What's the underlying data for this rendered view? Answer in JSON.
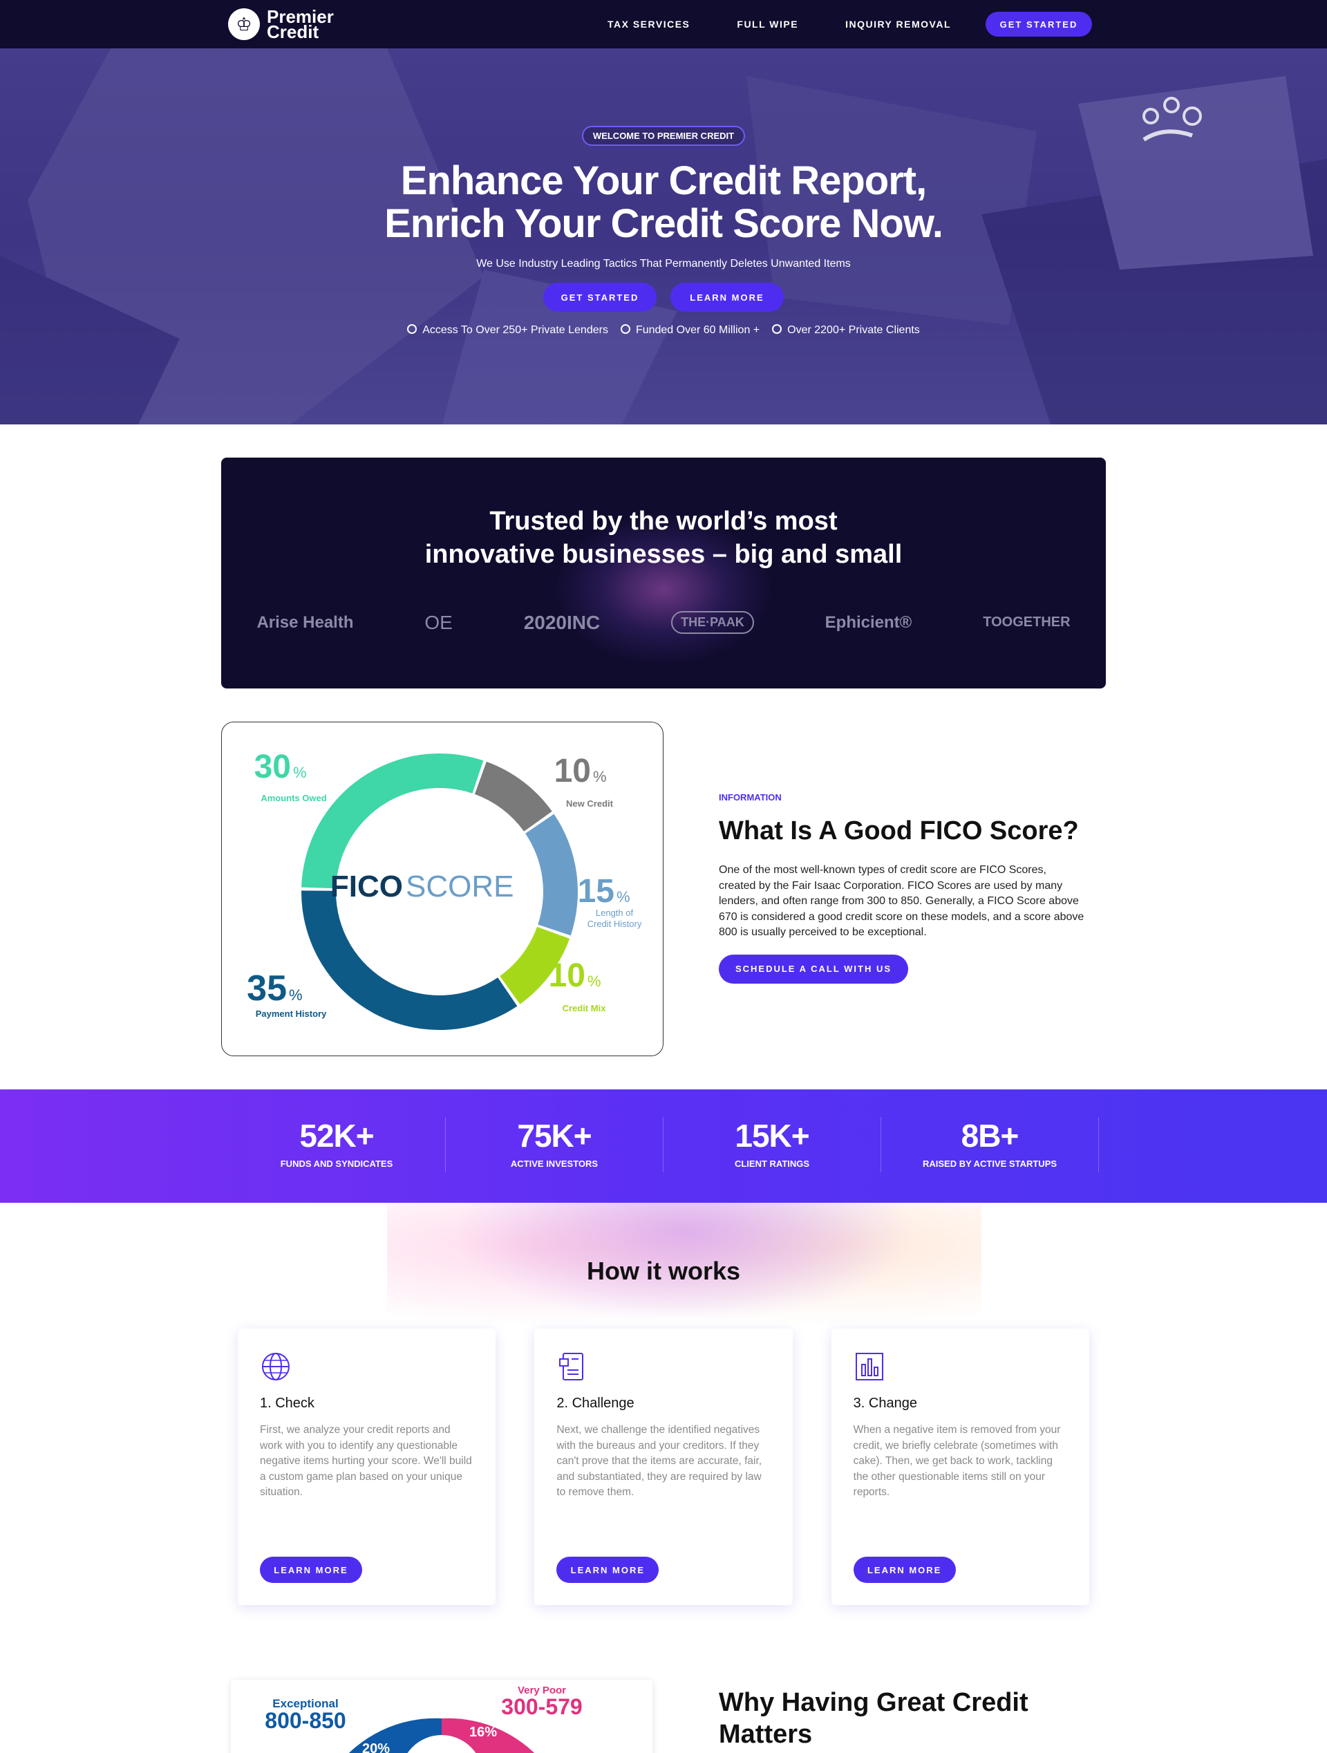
{
  "nav": {
    "logo_line1": "Premier",
    "logo_line2": "Credit",
    "links": [
      "TAX SERVICES",
      "FULL WIPE",
      "INQUIRY REMOVAL"
    ],
    "cta": "GET STARTED"
  },
  "hero": {
    "pill": "WELCOME TO PREMIER CREDIT",
    "title_line1": "Enhance Your Credit Report,",
    "title_line2": "Enrich Your Credit Score Now.",
    "subtitle": "We Use Industry Leading Tactics That Permanently Deletes Unwanted Items",
    "btn_primary": "GET STARTED",
    "btn_secondary": "LEARN MORE",
    "bullets": [
      "Access To Over 250+ Private Lenders",
      "Funded Over 60 Million +",
      "Over 2200+ Private Clients"
    ]
  },
  "trusted": {
    "title_line1": "Trusted by the world’s most",
    "title_line2": "innovative businesses – big and small",
    "brands": [
      "Arise Health",
      "OE",
      "2020INC",
      "THE·PAAK",
      "Ephicient®",
      "TOOGETHER"
    ]
  },
  "fico": {
    "center_bold": "FICO",
    "center_light": "SCORE",
    "segments": [
      {
        "pct": "30",
        "label": "Amounts Owed",
        "color": "#3fd6a8",
        "value": 30
      },
      {
        "pct": "10",
        "label": "New Credit",
        "color": "#7a7a7a",
        "value": 10
      },
      {
        "pct": "15",
        "label1": "Length of",
        "label2": "Credit History",
        "color": "#6a9ec8",
        "value": 15
      },
      {
        "pct": "10",
        "label": "Credit Mix",
        "color": "#a6d81a",
        "value": 10
      },
      {
        "pct": "35",
        "label": "Payment History",
        "color": "#0e5a86",
        "value": 35
      }
    ],
    "tag": "INFORMATION",
    "title": "What Is A Good FICO Score?",
    "body": "One of the most well-known types of credit score are FICO Scores, created by the Fair Isaac Corporation. FICO Scores are used by many lenders, and often range from 300 to 850. Generally, a FICO Score above 670 is considered a good credit score on these models, and a score above 800 is usually perceived to be exceptional.",
    "cta": "SCHEDULE A CALL WITH US"
  },
  "stats": [
    {
      "num": "52K+",
      "label": "FUNDS AND SYNDICATES"
    },
    {
      "num": "75K+",
      "label": "ACTIVE INVESTORS"
    },
    {
      "num": "15K+",
      "label": "CLIENT RATINGS"
    },
    {
      "num": "8B+",
      "label": "RAISED BY ACTIVE STARTUPS"
    }
  ],
  "how": {
    "title": "How it works",
    "cards": [
      {
        "icon": "globe-icon",
        "title": "1. Check",
        "body": "First, we analyze your credit reports and work with you to identify any questionable negative items hurting your score. We'll build a custom game plan based on your unique situation.",
        "cta": "LEARN MORE"
      },
      {
        "icon": "document-icon",
        "title": "2. Challenge",
        "body": "Next, we challenge the identified negatives with the bureaus and your creditors. If they can't prove that the items are accurate, fair, and substantiated, they are required by law to remove them.",
        "cta": "LEARN MORE"
      },
      {
        "icon": "bar-chart-icon",
        "title": "3. Change",
        "body": "When a negative item is removed from your credit, we briefly celebrate (sometimes with cake). Then, we get back to work, tackling the other questionable items still on your reports.",
        "cta": "LEARN MORE"
      }
    ]
  },
  "why": {
    "title_line1": "Why Having Great Credit",
    "title_line2": "Matters",
    "gauge": {
      "left_label": "Exceptional",
      "left_range": "800-850",
      "left_pct": "20%",
      "right_label": "Very Poor",
      "right_range": "300-579",
      "right_pct": "16%"
    }
  },
  "colors": {
    "accent": "#4f2df0",
    "navy": "#100c2e"
  }
}
